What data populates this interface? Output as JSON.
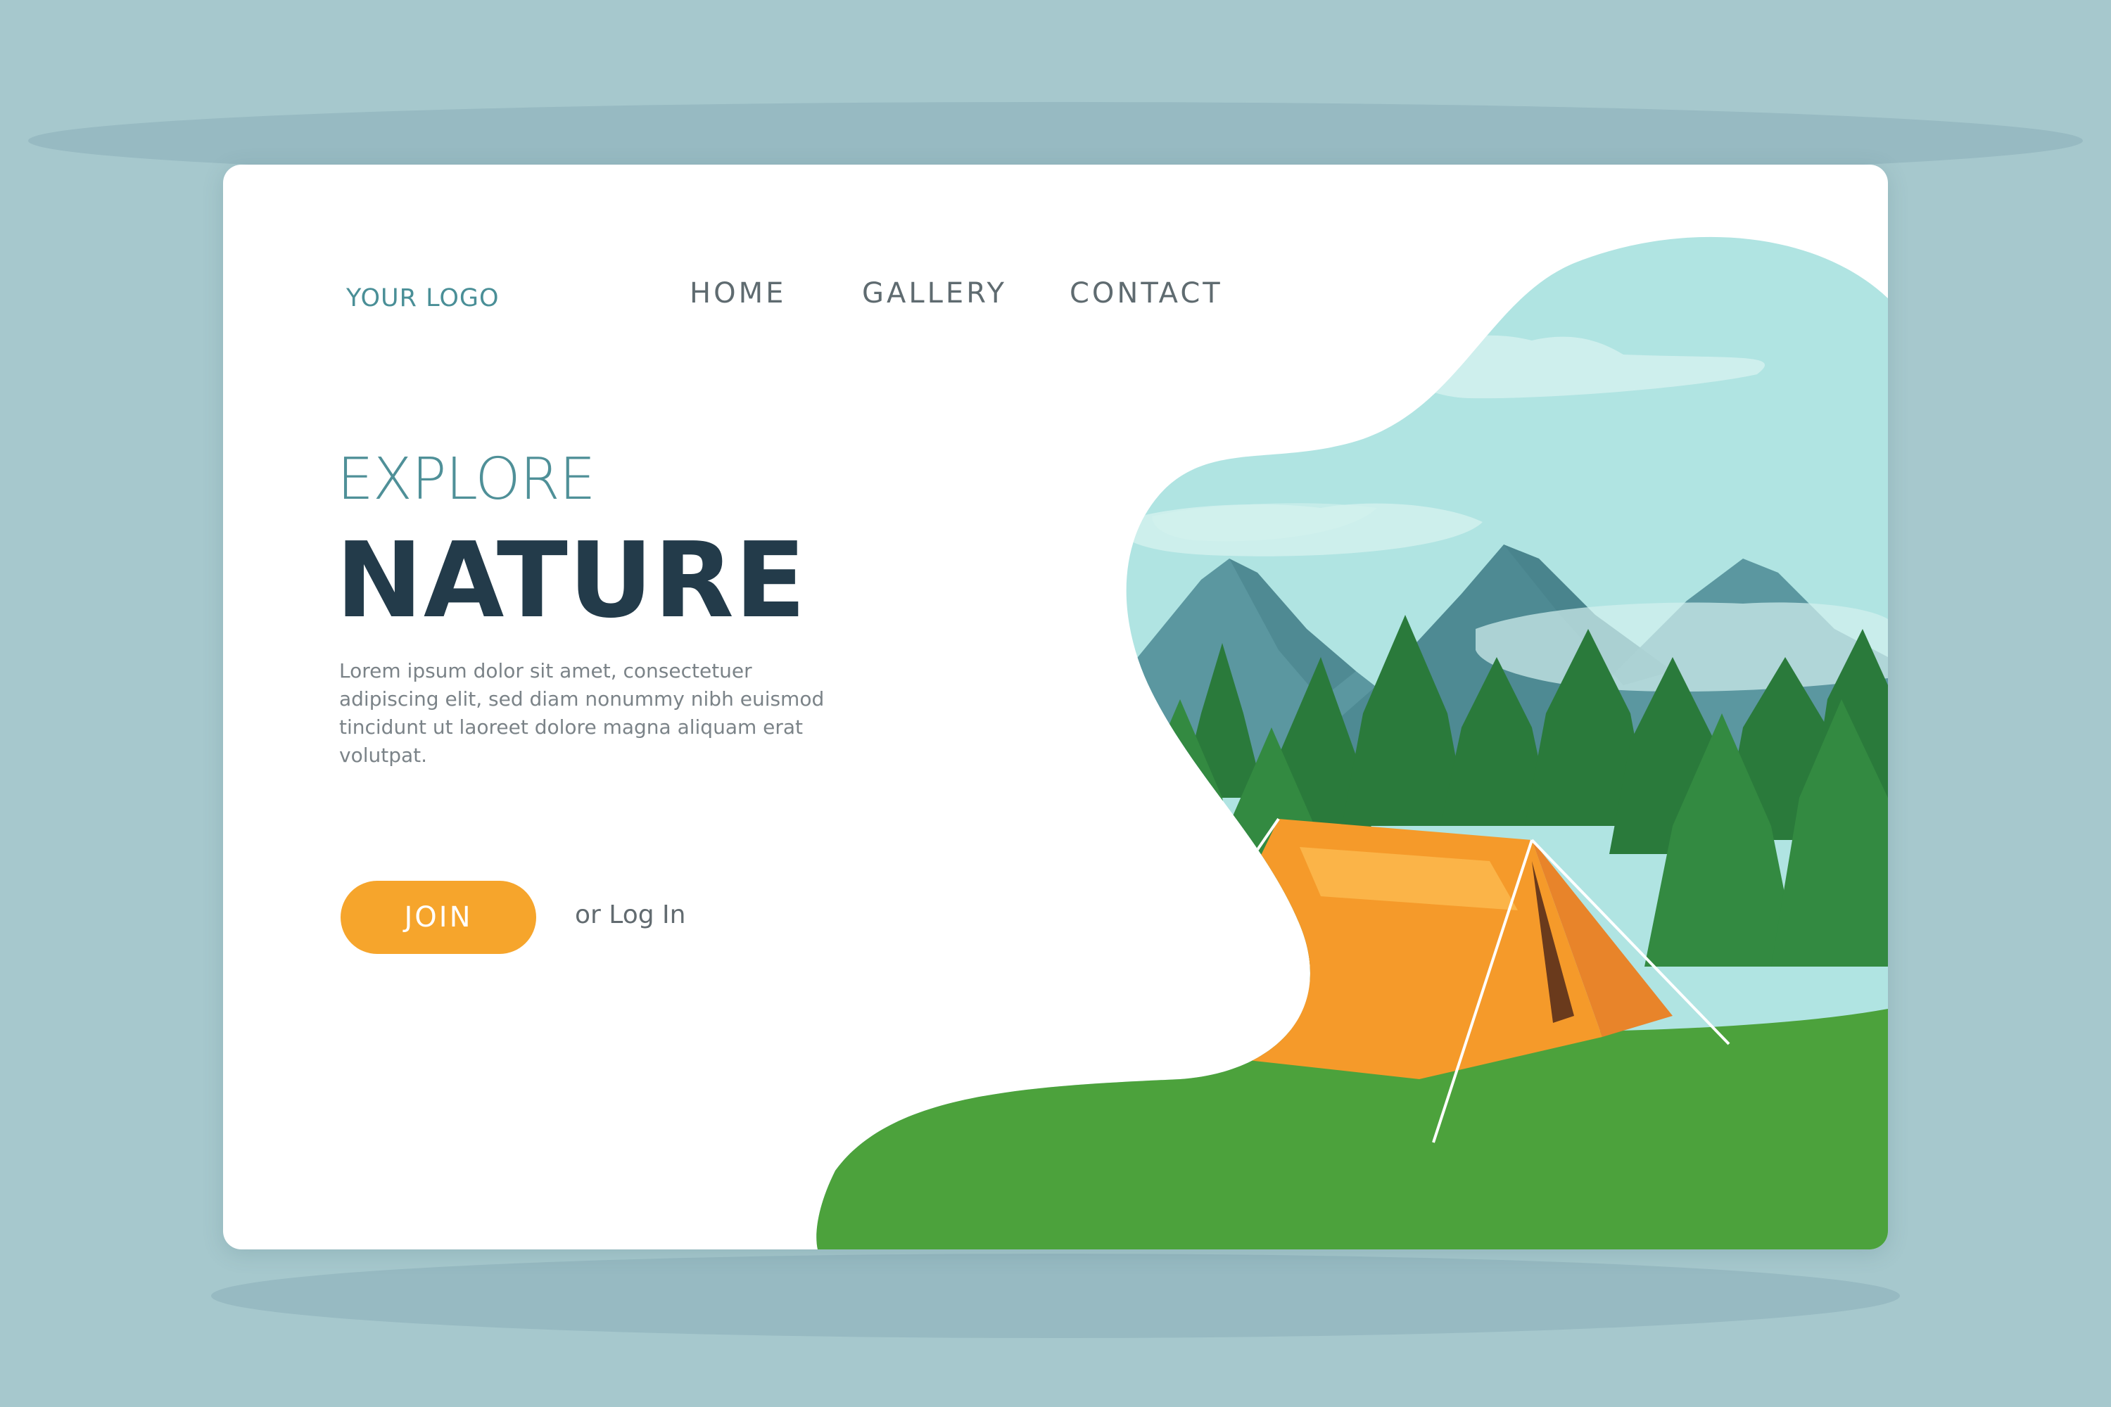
{
  "header": {
    "logo": "YOUR LOGO",
    "nav": [
      {
        "label": "HOME"
      },
      {
        "label": "GALLERY"
      },
      {
        "label": "CONTACT"
      }
    ]
  },
  "hero": {
    "eyebrow": "EXPLORE",
    "headline": "NATURE",
    "body": "Lorem ipsum dolor sit amet, consectetuer adipiscing elit, sed diam nonummy nibh euismod tincidunt ut laoreet dolore magna aliquam erat volutpat.",
    "join_label": "JOIN",
    "login_label": "or Log In"
  },
  "colors": {
    "page_background": "#a6c8cd",
    "card_background": "#ffffff",
    "accent": "#f6a52c",
    "headline": "#233b4a",
    "logo": "#4a8f97",
    "sky": "#b0e4e2",
    "mountains": "#5b97a0",
    "forest": "#2e7f3d",
    "grass": "#4ca23c",
    "tent": "#f59a2a"
  },
  "illustration": {
    "subject": "tent-camping-scene",
    "elements": [
      "sky",
      "clouds",
      "mountains",
      "pine-trees",
      "grass",
      "tent"
    ]
  }
}
